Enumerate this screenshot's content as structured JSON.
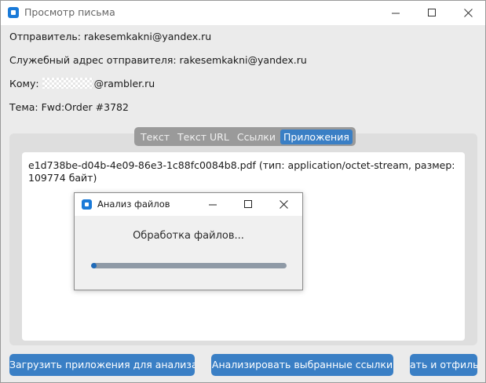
{
  "window": {
    "title": "Просмотр письма",
    "icon": "app-icon"
  },
  "fields": {
    "sender": "Отправитель: rakesemkakni@yandex.ru",
    "service_sender": "Служебный адрес отправителя: rakesemkakni@yandex.ru",
    "to_label": "Кому:",
    "to_domain": "@rambler.ru",
    "subject": "Тема: Fwd:Order #3782"
  },
  "tabs": [
    {
      "label": "Текст",
      "active": false
    },
    {
      "label": "Текст URL",
      "active": false
    },
    {
      "label": "Ссылки",
      "active": false
    },
    {
      "label": "Приложения",
      "active": true
    }
  ],
  "attachment_text": "e1d738be-d04b-4e09-86e3-1c88fc0084b8.pdf (тип: application/octet-stream, размер: 109774 байт)",
  "dialog": {
    "title": "Анализ файлов",
    "message": "Обработка файлов...",
    "progress": 0.03
  },
  "buttons": {
    "upload": "Загрузить приложения для анализа",
    "analyze_links": "Анализировать выбранные ссылки",
    "third": "ать и отфиль"
  },
  "colors": {
    "accent": "#3a7fc5",
    "tab_bar": "#9a9a9a",
    "progress_track": "#8f9aa6",
    "progress_fill": "#1f6bb9"
  }
}
